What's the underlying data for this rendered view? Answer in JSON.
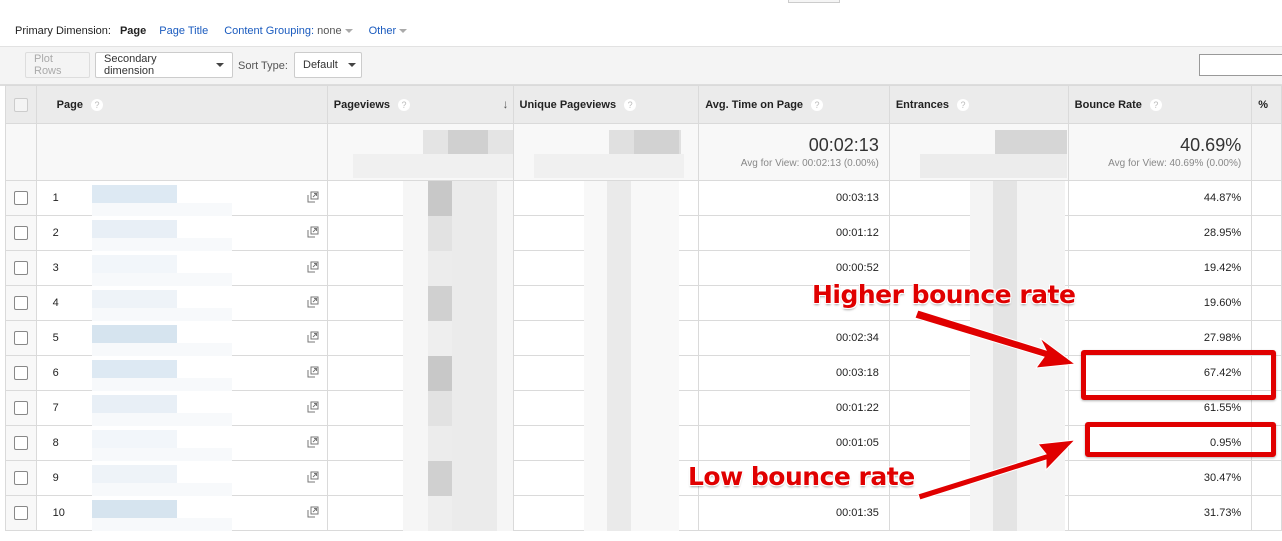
{
  "primary_dimension": {
    "label": "Primary Dimension:",
    "selected": "Page",
    "options": [
      "Page Title"
    ],
    "content_grouping_label": "Content Grouping:",
    "content_grouping_value": "none",
    "other_label": "Other"
  },
  "toolbar": {
    "plot_rows": "Plot Rows",
    "secondary_dimension": "Secondary dimension",
    "sort_type_label": "Sort Type:",
    "sort_type_value": "Default",
    "search_value": ""
  },
  "table": {
    "headers": [
      "Page",
      "Pageviews",
      "Unique Pageviews",
      "Avg. Time on Page",
      "Entrances",
      "Bounce Rate",
      "%"
    ],
    "sorted_column": "Pageviews",
    "summary": {
      "avg_time": "00:02:13",
      "avg_time_note": "Avg for View: 00:02:13 (0.00%)",
      "bounce_rate": "40.69%",
      "bounce_rate_note": "Avg for View: 40.69% (0.00%)"
    },
    "rows": [
      {
        "n": "1",
        "avg_time": "00:03:13",
        "bounce": "44.87%"
      },
      {
        "n": "2",
        "avg_time": "00:01:12",
        "bounce": "28.95%"
      },
      {
        "n": "3",
        "avg_time": "00:00:52",
        "bounce": "19.42%"
      },
      {
        "n": "4",
        "avg_time": "",
        "bounce": "19.60%"
      },
      {
        "n": "5",
        "avg_time": "00:02:34",
        "bounce": "27.98%"
      },
      {
        "n": "6",
        "avg_time": "00:03:18",
        "bounce": "67.42%"
      },
      {
        "n": "7",
        "avg_time": "00:01:22",
        "bounce": "61.55%"
      },
      {
        "n": "8",
        "avg_time": "00:01:05",
        "bounce": "0.95%"
      },
      {
        "n": "9",
        "avg_time": "",
        "bounce": "30.47%"
      },
      {
        "n": "10",
        "avg_time": "00:01:35",
        "bounce": "31.73%"
      }
    ]
  },
  "annotations": {
    "higher": "Higher bounce rate",
    "low": "Low bounce rate",
    "color": "#e00000"
  }
}
